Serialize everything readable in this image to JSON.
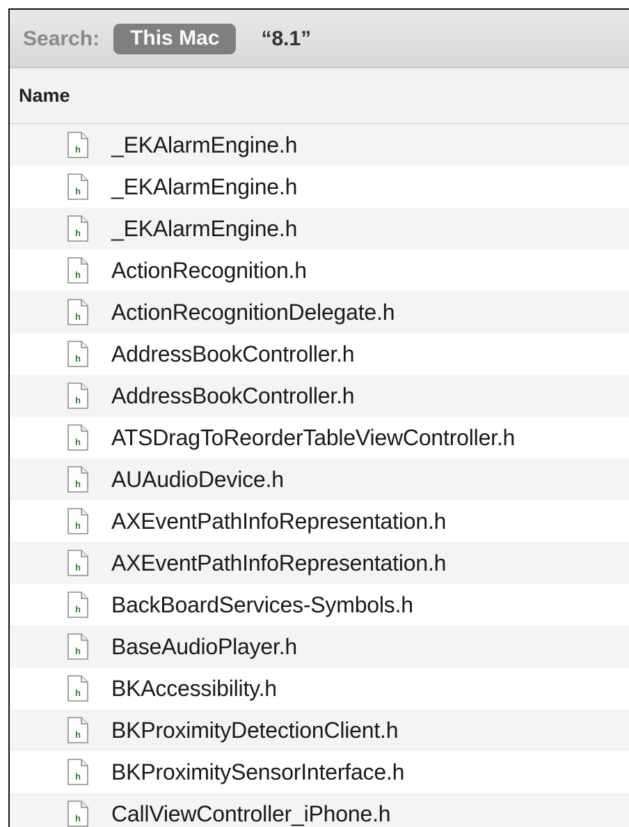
{
  "search": {
    "label": "Search:",
    "scope": "This Mac",
    "term": "“8.1”"
  },
  "columns": {
    "name": "Name"
  },
  "files": [
    {
      "name": "_EKAlarmEngine.h",
      "icon": "header-file-icon"
    },
    {
      "name": "_EKAlarmEngine.h",
      "icon": "header-file-icon"
    },
    {
      "name": "_EKAlarmEngine.h",
      "icon": "header-file-icon"
    },
    {
      "name": "ActionRecognition.h",
      "icon": "header-file-icon"
    },
    {
      "name": "ActionRecognitionDelegate.h",
      "icon": "header-file-icon"
    },
    {
      "name": "AddressBookController.h",
      "icon": "header-file-icon"
    },
    {
      "name": "AddressBookController.h",
      "icon": "header-file-icon"
    },
    {
      "name": "ATSDragToReorderTableViewController.h",
      "icon": "header-file-icon"
    },
    {
      "name": "AUAudioDevice.h",
      "icon": "header-file-icon"
    },
    {
      "name": "AXEventPathInfoRepresentation.h",
      "icon": "header-file-icon"
    },
    {
      "name": "AXEventPathInfoRepresentation.h",
      "icon": "header-file-icon"
    },
    {
      "name": "BackBoardServices-Symbols.h",
      "icon": "header-file-icon"
    },
    {
      "name": "BaseAudioPlayer.h",
      "icon": "header-file-icon"
    },
    {
      "name": "BKAccessibility.h",
      "icon": "header-file-icon"
    },
    {
      "name": "BKProximityDetectionClient.h",
      "icon": "header-file-icon"
    },
    {
      "name": "BKProximitySensorInterface.h",
      "icon": "header-file-icon"
    },
    {
      "name": "CallViewController_iPhone.h",
      "icon": "header-file-icon"
    }
  ],
  "icon_glyph": "h",
  "colors": {
    "scope_pill": "#7f7f7f",
    "icon_letter": "#2e7d32"
  }
}
